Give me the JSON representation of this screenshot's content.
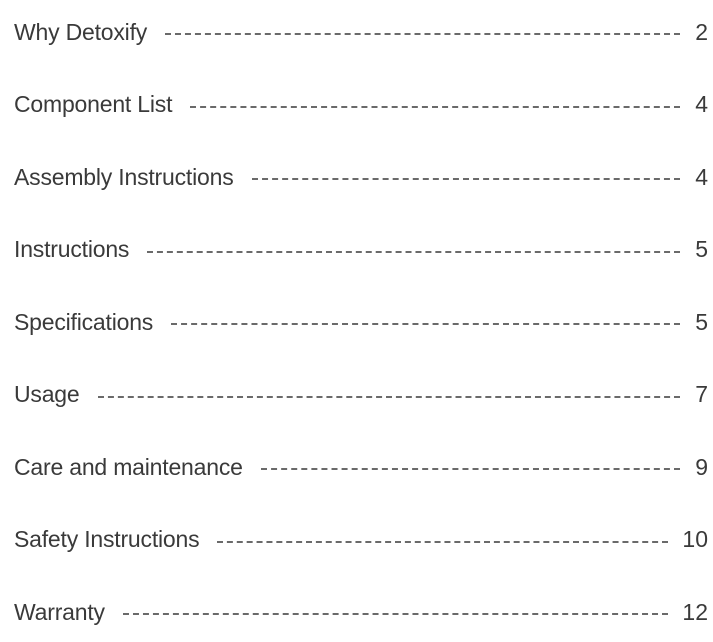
{
  "toc": {
    "entries": [
      {
        "title": "Why Detoxify",
        "page": "2"
      },
      {
        "title": "Component List",
        "page": "4"
      },
      {
        "title": "Assembly Instructions",
        "page": "4"
      },
      {
        "title": "Instructions",
        "page": "5"
      },
      {
        "title": "Specifications",
        "page": "5"
      },
      {
        "title": "Usage",
        "page": "7"
      },
      {
        "title": "Care and maintenance",
        "page": "9"
      },
      {
        "title": "Safety Instructions",
        "page": "10"
      },
      {
        "title": "Warranty",
        "page": "12"
      }
    ]
  }
}
